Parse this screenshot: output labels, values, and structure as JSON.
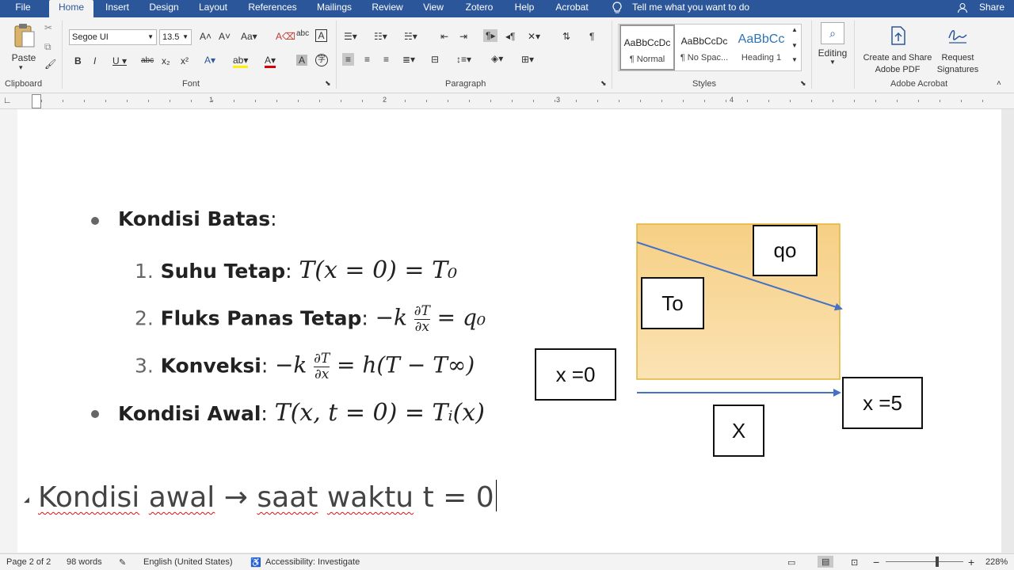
{
  "tabs": [
    "File",
    "Home",
    "Insert",
    "Design",
    "Layout",
    "References",
    "Mailings",
    "Review",
    "View",
    "Zotero",
    "Help",
    "Acrobat"
  ],
  "active_tab": "Home",
  "tell_me": "Tell me what you want to do",
  "share": "Share",
  "clipboard": {
    "paste": "Paste",
    "label": "Clipboard"
  },
  "font": {
    "name": "Segoe UI",
    "size": "13.5",
    "label": "Font"
  },
  "paragraph": {
    "label": "Paragraph"
  },
  "styles": {
    "label": "Styles",
    "items": [
      {
        "preview": "AaBbCcDc",
        "name": "¶ Normal"
      },
      {
        "preview": "AaBbCcDc",
        "name": "¶ No Spac..."
      },
      {
        "preview": "AaBbCc",
        "name": "Heading 1"
      }
    ]
  },
  "editing": "Editing",
  "acrobat": {
    "create": "Create and Share Adobe PDF",
    "request": "Request Signatures",
    "label": "Adobe Acrobat"
  },
  "ruler_numbers": [
    "1",
    "2",
    "3",
    "4"
  ],
  "doc": {
    "kondisi_batas": "Kondisi Batas",
    "item1_label": "Suhu Tetap",
    "item1_eq": "T(x = 0) = T₀",
    "item2_label": "Fluks Panas Tetap",
    "item2_eq_pre": "−k",
    "item2_frac_num": "∂T",
    "item2_frac_den": "∂x",
    "item2_eq_post": "= q₀",
    "item3_label": "Konveksi",
    "item3_eq_pre": "−k",
    "item3_frac_num": "∂T",
    "item3_frac_den": "∂x",
    "item3_eq_post": "= h(T − T∞)",
    "kondisi_awal": "Kondisi Awal",
    "awal_eq": "T(x, t = 0) = Tᵢ(x)",
    "n1": "1.",
    "n2": "2.",
    "n3": "3.",
    "bottom_word1": "Kondisi",
    "bottom_word2": "awal",
    "bottom_arrow": "→",
    "bottom_word3": "saat",
    "bottom_word4": "waktu",
    "bottom_rest": "t = 0"
  },
  "diagram": {
    "box_fill_top": "#f6cf84",
    "box_fill_bottom": "#fbe3b4",
    "arrow_color": "#4472c4",
    "qo": "qo",
    "to": "To",
    "x0": "x =0",
    "x5": "x =5",
    "X": "X"
  },
  "status": {
    "page": "Page 2 of 2",
    "words": "98 words",
    "language": "English (United States)",
    "accessibility": "Accessibility: Investigate",
    "zoom": "228%"
  }
}
